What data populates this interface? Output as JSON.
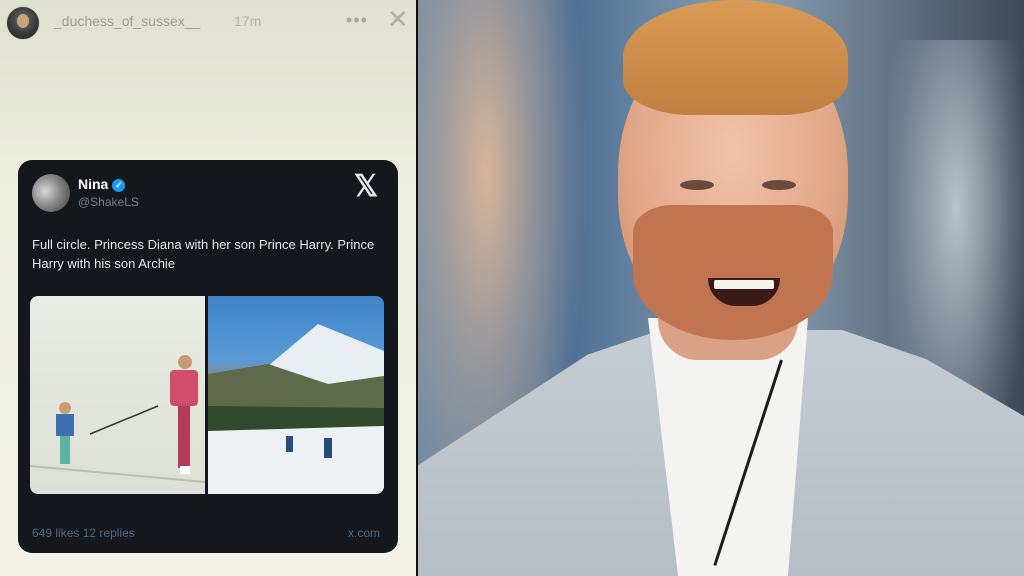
{
  "story": {
    "username": "_duchess_of_sussex__",
    "time": "17m",
    "more_icon": "more-dots-icon",
    "close_icon": "close-icon"
  },
  "tweet": {
    "name": "Nina",
    "handle": "@ShakeLS",
    "verified": true,
    "text": "Full circle. Princess Diana with her son Prince Harry. Prince Harry with his son Archie",
    "likes": "649 likes",
    "replies": "12 replies",
    "source": "x.com"
  },
  "colors": {
    "card_bg": "#14171c",
    "story_bg": "#eef0de",
    "verified_badge": "#1d9bf0",
    "footer_text": "#4f6b86"
  }
}
